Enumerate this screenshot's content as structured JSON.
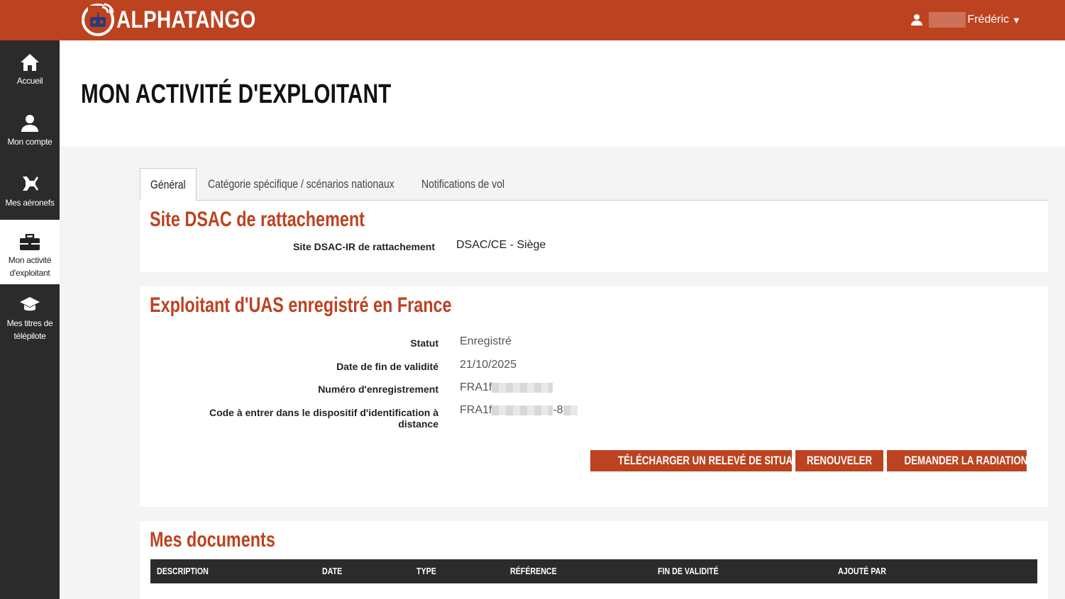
{
  "header": {
    "logo_text": "ALPHATANGO",
    "user_name": "Frédéric",
    "user_caret": "▼"
  },
  "sidebar": {
    "items": [
      {
        "label": "Accueil",
        "icon": "home-icon"
      },
      {
        "label": "Mon compte",
        "icon": "user-icon"
      },
      {
        "label": "Mes aéronefs",
        "icon": "drone-icon"
      },
      {
        "label": "Mon activité d'exploitant",
        "icon": "briefcase-icon",
        "active": true
      },
      {
        "label": "Mes titres de télépilote",
        "icon": "graduation-cap-icon"
      }
    ]
  },
  "page": {
    "title": "MON ACTIVITÉ D'EXPLOITANT"
  },
  "tabs": [
    {
      "label": "Général",
      "active": true
    },
    {
      "label": "Catégorie spécifique / scénarios nationaux"
    },
    {
      "label": "Notifications de vol"
    }
  ],
  "dsac": {
    "title": "Site DSAC de rattachement",
    "label": "Site DSAC-IR de rattachement",
    "value": "DSAC/CE - Siège"
  },
  "exploitant": {
    "title": "Exploitant d'UAS enregistré en France",
    "fields": [
      {
        "label": "Statut",
        "value": "Enregistré"
      },
      {
        "label": "Date de fin de validité",
        "value": "21/10/2025"
      },
      {
        "label": "Numéro d'enregistrement",
        "value_prefix": "FRA1f"
      },
      {
        "label": "Code à entrer dans le dispositif d'identification à distance",
        "value_prefix": "FRA1f",
        "value_suffix": "-8"
      }
    ],
    "buttons": {
      "download": "TÉLÉCHARGER UN RELEVÉ DE SITUATION",
      "renew": "RENOUVELER",
      "radiation": "DEMANDER LA RADIATION"
    }
  },
  "documents": {
    "title": "Mes documents",
    "columns": [
      "DESCRIPTION",
      "DATE",
      "TYPE",
      "RÉFÉRENCE",
      "FIN DE VALIDITÉ",
      "AJOUTÉ PAR"
    ]
  },
  "colors": {
    "brand": "#bd4220",
    "sidebar": "#2b2b2b"
  }
}
